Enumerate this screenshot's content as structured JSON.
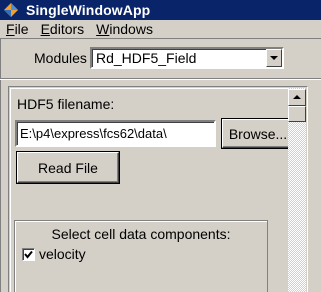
{
  "window": {
    "title": "SingleWindowApp",
    "icon": "app-diamond-icon"
  },
  "menubar": {
    "items": [
      {
        "accel": "F",
        "rest": "ile"
      },
      {
        "accel": "E",
        "rest": "ditors"
      },
      {
        "accel": "W",
        "rest": "indows"
      }
    ]
  },
  "modules": {
    "label": "Modules",
    "selected": "Rd_HDF5_Field"
  },
  "hdf5": {
    "label": "HDF5 filename:",
    "value": "E:\\p4\\express\\fcs62\\data\\",
    "browse_label": "Browse...",
    "read_label": "Read File"
  },
  "cell_data": {
    "title": "Select cell data components:",
    "items": [
      {
        "label": "velocity",
        "checked": true
      }
    ]
  },
  "colors": {
    "titlebar": "#0a246a",
    "face": "#d4d0c8"
  }
}
